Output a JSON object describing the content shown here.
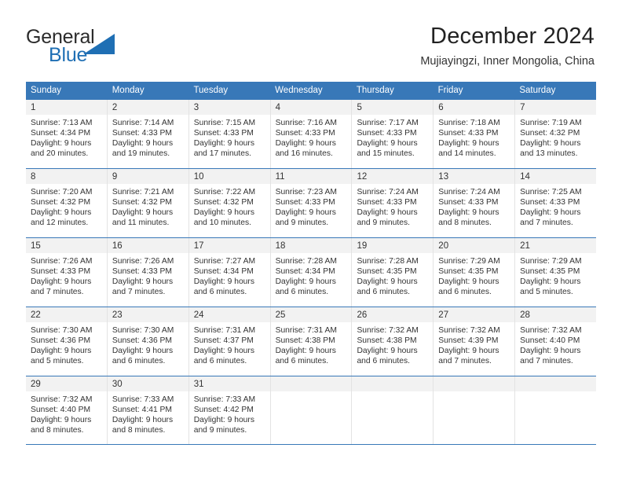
{
  "brand": {
    "name_part1": "General",
    "name_part2": "Blue",
    "accent_color": "#1f6fb4",
    "logo_icon": "triangle-icon"
  },
  "header": {
    "title": "December 2024",
    "subtitle": "Mujiayingzi, Inner Mongolia, China"
  },
  "calendar": {
    "header_bg": "#3878b8",
    "weekdays": [
      "Sunday",
      "Monday",
      "Tuesday",
      "Wednesday",
      "Thursday",
      "Friday",
      "Saturday"
    ],
    "weeks": [
      [
        {
          "day": "1",
          "sunrise": "Sunrise: 7:13 AM",
          "sunset": "Sunset: 4:34 PM",
          "daylight_1": "Daylight: 9 hours",
          "daylight_2": "and 20 minutes."
        },
        {
          "day": "2",
          "sunrise": "Sunrise: 7:14 AM",
          "sunset": "Sunset: 4:33 PM",
          "daylight_1": "Daylight: 9 hours",
          "daylight_2": "and 19 minutes."
        },
        {
          "day": "3",
          "sunrise": "Sunrise: 7:15 AM",
          "sunset": "Sunset: 4:33 PM",
          "daylight_1": "Daylight: 9 hours",
          "daylight_2": "and 17 minutes."
        },
        {
          "day": "4",
          "sunrise": "Sunrise: 7:16 AM",
          "sunset": "Sunset: 4:33 PM",
          "daylight_1": "Daylight: 9 hours",
          "daylight_2": "and 16 minutes."
        },
        {
          "day": "5",
          "sunrise": "Sunrise: 7:17 AM",
          "sunset": "Sunset: 4:33 PM",
          "daylight_1": "Daylight: 9 hours",
          "daylight_2": "and 15 minutes."
        },
        {
          "day": "6",
          "sunrise": "Sunrise: 7:18 AM",
          "sunset": "Sunset: 4:33 PM",
          "daylight_1": "Daylight: 9 hours",
          "daylight_2": "and 14 minutes."
        },
        {
          "day": "7",
          "sunrise": "Sunrise: 7:19 AM",
          "sunset": "Sunset: 4:32 PM",
          "daylight_1": "Daylight: 9 hours",
          "daylight_2": "and 13 minutes."
        }
      ],
      [
        {
          "day": "8",
          "sunrise": "Sunrise: 7:20 AM",
          "sunset": "Sunset: 4:32 PM",
          "daylight_1": "Daylight: 9 hours",
          "daylight_2": "and 12 minutes."
        },
        {
          "day": "9",
          "sunrise": "Sunrise: 7:21 AM",
          "sunset": "Sunset: 4:32 PM",
          "daylight_1": "Daylight: 9 hours",
          "daylight_2": "and 11 minutes."
        },
        {
          "day": "10",
          "sunrise": "Sunrise: 7:22 AM",
          "sunset": "Sunset: 4:32 PM",
          "daylight_1": "Daylight: 9 hours",
          "daylight_2": "and 10 minutes."
        },
        {
          "day": "11",
          "sunrise": "Sunrise: 7:23 AM",
          "sunset": "Sunset: 4:33 PM",
          "daylight_1": "Daylight: 9 hours",
          "daylight_2": "and 9 minutes."
        },
        {
          "day": "12",
          "sunrise": "Sunrise: 7:24 AM",
          "sunset": "Sunset: 4:33 PM",
          "daylight_1": "Daylight: 9 hours",
          "daylight_2": "and 9 minutes."
        },
        {
          "day": "13",
          "sunrise": "Sunrise: 7:24 AM",
          "sunset": "Sunset: 4:33 PM",
          "daylight_1": "Daylight: 9 hours",
          "daylight_2": "and 8 minutes."
        },
        {
          "day": "14",
          "sunrise": "Sunrise: 7:25 AM",
          "sunset": "Sunset: 4:33 PM",
          "daylight_1": "Daylight: 9 hours",
          "daylight_2": "and 7 minutes."
        }
      ],
      [
        {
          "day": "15",
          "sunrise": "Sunrise: 7:26 AM",
          "sunset": "Sunset: 4:33 PM",
          "daylight_1": "Daylight: 9 hours",
          "daylight_2": "and 7 minutes."
        },
        {
          "day": "16",
          "sunrise": "Sunrise: 7:26 AM",
          "sunset": "Sunset: 4:33 PM",
          "daylight_1": "Daylight: 9 hours",
          "daylight_2": "and 7 minutes."
        },
        {
          "day": "17",
          "sunrise": "Sunrise: 7:27 AM",
          "sunset": "Sunset: 4:34 PM",
          "daylight_1": "Daylight: 9 hours",
          "daylight_2": "and 6 minutes."
        },
        {
          "day": "18",
          "sunrise": "Sunrise: 7:28 AM",
          "sunset": "Sunset: 4:34 PM",
          "daylight_1": "Daylight: 9 hours",
          "daylight_2": "and 6 minutes."
        },
        {
          "day": "19",
          "sunrise": "Sunrise: 7:28 AM",
          "sunset": "Sunset: 4:35 PM",
          "daylight_1": "Daylight: 9 hours",
          "daylight_2": "and 6 minutes."
        },
        {
          "day": "20",
          "sunrise": "Sunrise: 7:29 AM",
          "sunset": "Sunset: 4:35 PM",
          "daylight_1": "Daylight: 9 hours",
          "daylight_2": "and 6 minutes."
        },
        {
          "day": "21",
          "sunrise": "Sunrise: 7:29 AM",
          "sunset": "Sunset: 4:35 PM",
          "daylight_1": "Daylight: 9 hours",
          "daylight_2": "and 5 minutes."
        }
      ],
      [
        {
          "day": "22",
          "sunrise": "Sunrise: 7:30 AM",
          "sunset": "Sunset: 4:36 PM",
          "daylight_1": "Daylight: 9 hours",
          "daylight_2": "and 5 minutes."
        },
        {
          "day": "23",
          "sunrise": "Sunrise: 7:30 AM",
          "sunset": "Sunset: 4:36 PM",
          "daylight_1": "Daylight: 9 hours",
          "daylight_2": "and 6 minutes."
        },
        {
          "day": "24",
          "sunrise": "Sunrise: 7:31 AM",
          "sunset": "Sunset: 4:37 PM",
          "daylight_1": "Daylight: 9 hours",
          "daylight_2": "and 6 minutes."
        },
        {
          "day": "25",
          "sunrise": "Sunrise: 7:31 AM",
          "sunset": "Sunset: 4:38 PM",
          "daylight_1": "Daylight: 9 hours",
          "daylight_2": "and 6 minutes."
        },
        {
          "day": "26",
          "sunrise": "Sunrise: 7:32 AM",
          "sunset": "Sunset: 4:38 PM",
          "daylight_1": "Daylight: 9 hours",
          "daylight_2": "and 6 minutes."
        },
        {
          "day": "27",
          "sunrise": "Sunrise: 7:32 AM",
          "sunset": "Sunset: 4:39 PM",
          "daylight_1": "Daylight: 9 hours",
          "daylight_2": "and 7 minutes."
        },
        {
          "day": "28",
          "sunrise": "Sunrise: 7:32 AM",
          "sunset": "Sunset: 4:40 PM",
          "daylight_1": "Daylight: 9 hours",
          "daylight_2": "and 7 minutes."
        }
      ],
      [
        {
          "day": "29",
          "sunrise": "Sunrise: 7:32 AM",
          "sunset": "Sunset: 4:40 PM",
          "daylight_1": "Daylight: 9 hours",
          "daylight_2": "and 8 minutes."
        },
        {
          "day": "30",
          "sunrise": "Sunrise: 7:33 AM",
          "sunset": "Sunset: 4:41 PM",
          "daylight_1": "Daylight: 9 hours",
          "daylight_2": "and 8 minutes."
        },
        {
          "day": "31",
          "sunrise": "Sunrise: 7:33 AM",
          "sunset": "Sunset: 4:42 PM",
          "daylight_1": "Daylight: 9 hours",
          "daylight_2": "and 9 minutes."
        },
        {
          "day": "",
          "sunrise": "",
          "sunset": "",
          "daylight_1": "",
          "daylight_2": ""
        },
        {
          "day": "",
          "sunrise": "",
          "sunset": "",
          "daylight_1": "",
          "daylight_2": ""
        },
        {
          "day": "",
          "sunrise": "",
          "sunset": "",
          "daylight_1": "",
          "daylight_2": ""
        },
        {
          "day": "",
          "sunrise": "",
          "sunset": "",
          "daylight_1": "",
          "daylight_2": ""
        }
      ]
    ]
  }
}
